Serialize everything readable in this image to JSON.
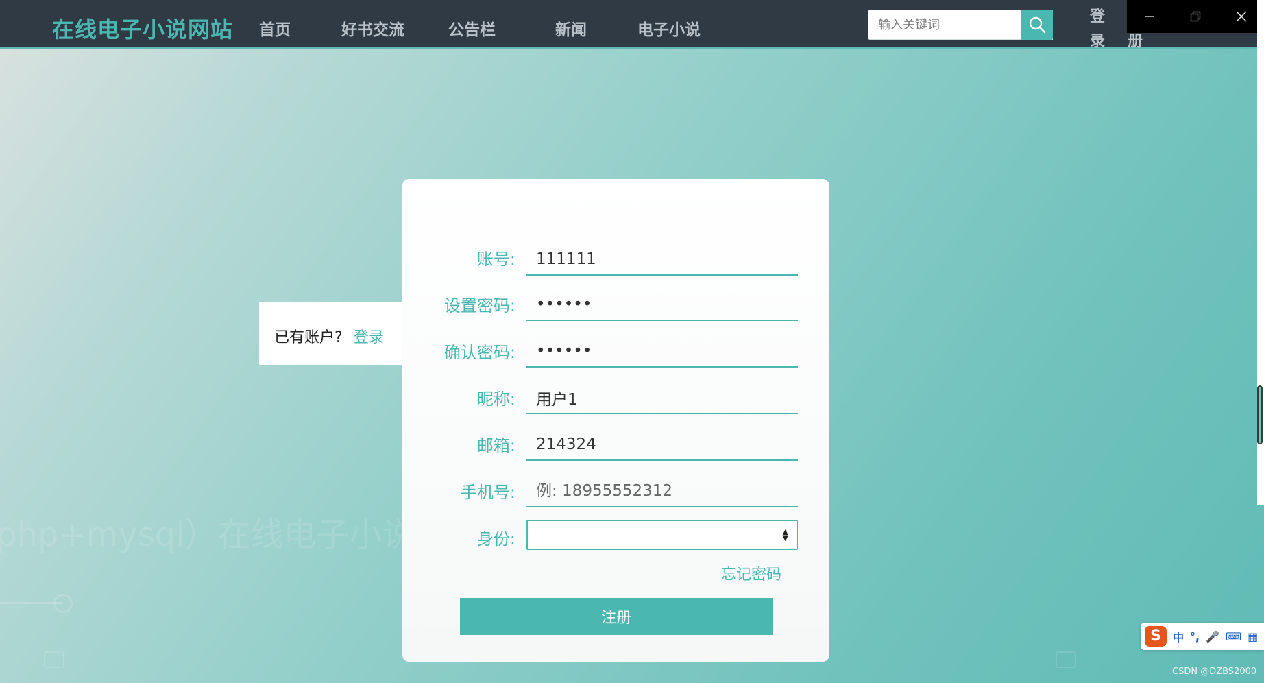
{
  "header": {
    "site_title": "在线电子小说网站",
    "nav": [
      "首页",
      "好书交流",
      "公告栏",
      "新闻",
      "电子小说"
    ],
    "search": {
      "placeholder": "输入关键词",
      "icon": "search-icon"
    },
    "login_label_chars": [
      "登",
      "录"
    ],
    "register_label_char": "册"
  },
  "background": {
    "faint_title": "php+mysql）在线电子小说"
  },
  "login_hint": {
    "text": "已有账户?",
    "link": "登录"
  },
  "form": {
    "fields": [
      {
        "label": "账号:",
        "value": "111111",
        "type": "text"
      },
      {
        "label": "设置密码:",
        "value": "••••••",
        "type": "password"
      },
      {
        "label": "确认密码:",
        "value": "••••••",
        "type": "password"
      },
      {
        "label": "昵称:",
        "value": "用户1",
        "type": "text"
      },
      {
        "label": "邮箱:",
        "value": "214324",
        "type": "text"
      },
      {
        "label": "手机号:",
        "value": "",
        "placeholder": "例: 18955552312",
        "type": "text"
      }
    ],
    "role": {
      "label": "身份:",
      "selected": ""
    },
    "forgot_password": "忘记密码",
    "submit": "注册"
  },
  "ime": {
    "logo": "S",
    "items": [
      "中",
      "°,",
      "🎤",
      "⌨",
      "▦"
    ]
  },
  "watermark": "CSDN @DZBS2000",
  "colors": {
    "accent": "#4ab8b1",
    "nav_bg": "#2f3a45",
    "nav_text": "#b9c1c8"
  }
}
